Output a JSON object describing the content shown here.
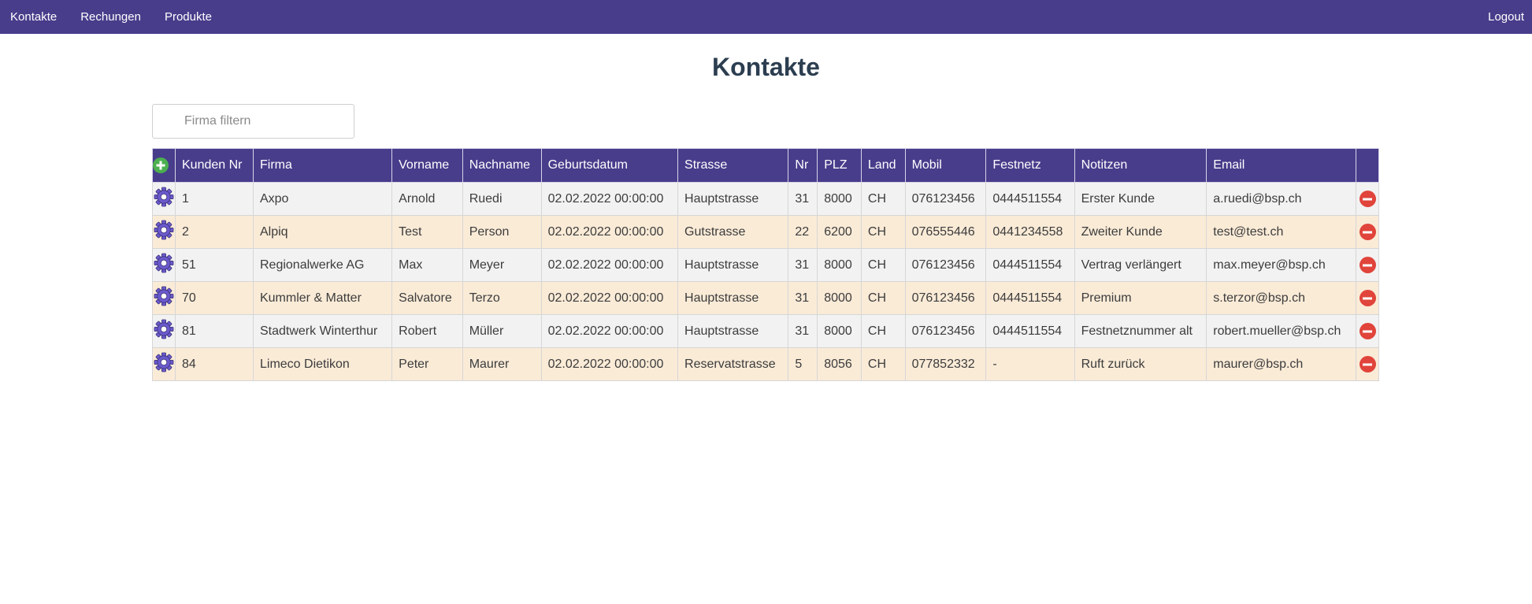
{
  "nav": {
    "items": [
      {
        "label": "Kontakte"
      },
      {
        "label": "Rechungen"
      },
      {
        "label": "Produkte"
      }
    ],
    "logout_label": "Logout"
  },
  "page": {
    "title": "Kontakte"
  },
  "filter": {
    "placeholder": "Firma filtern",
    "value": ""
  },
  "table": {
    "headers": [
      "Kunden Nr",
      "Firma",
      "Vorname",
      "Nachname",
      "Geburtsdatum",
      "Strasse",
      "Nr",
      "PLZ",
      "Land",
      "Mobil",
      "Festnetz",
      "Notitzen",
      "Email"
    ],
    "rows": [
      [
        "1",
        "Axpo",
        "Arnold",
        "Ruedi",
        "02.02.2022 00:00:00",
        "Hauptstrasse",
        "31",
        "8000",
        "CH",
        "076123456",
        "0444511554",
        "Erster Kunde",
        "a.ruedi@bsp.ch"
      ],
      [
        "2",
        "Alpiq",
        "Test",
        "Person",
        "02.02.2022 00:00:00",
        "Gutstrasse",
        "22",
        "6200",
        "CH",
        "076555446",
        "0441234558",
        "Zweiter Kunde",
        "test@test.ch"
      ],
      [
        "51",
        "Regionalwerke AG",
        "Max",
        "Meyer",
        "02.02.2022 00:00:00",
        "Hauptstrasse",
        "31",
        "8000",
        "CH",
        "076123456",
        "0444511554",
        "Vertrag verlängert",
        "max.meyer@bsp.ch"
      ],
      [
        "70",
        "Kummler & Matter",
        "Salvatore",
        "Terzo",
        "02.02.2022 00:00:00",
        "Hauptstrasse",
        "31",
        "8000",
        "CH",
        "076123456",
        "0444511554",
        "Premium",
        "s.terzor@bsp.ch"
      ],
      [
        "81",
        "Stadtwerk Winterthur",
        "Robert",
        "Müller",
        "02.02.2022 00:00:00",
        "Hauptstrasse",
        "31",
        "8000",
        "CH",
        "076123456",
        "0444511554",
        "Festnetznummer alt",
        "robert.mueller@bsp.ch"
      ],
      [
        "84",
        "Limeco Dietikon",
        "Peter",
        "Maurer",
        "02.02.2022 00:00:00",
        "Reservatstrasse",
        "5",
        "8056",
        "CH",
        "077852332",
        "-",
        "Ruft zurück",
        "maurer@bsp.ch"
      ]
    ]
  },
  "icons": {
    "add": "plus-circle-icon",
    "edit": "gear-icon",
    "delete": "minus-circle-icon"
  },
  "colors": {
    "accent": "#483d8b",
    "row_odd": "#f2f2f2",
    "row_even": "#faebd7",
    "add": "#4caf50",
    "delete": "#e0443a"
  }
}
